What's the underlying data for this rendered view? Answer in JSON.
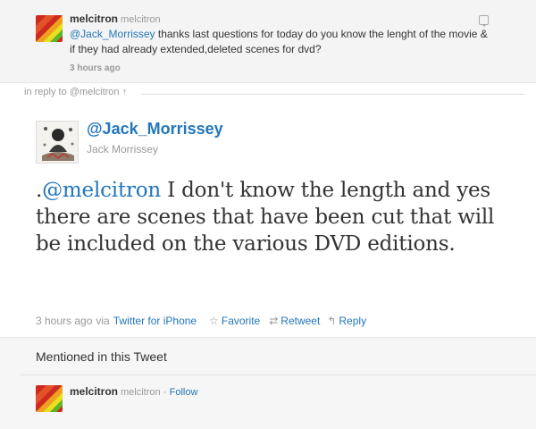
{
  "in_reply_to": {
    "user_name": "melcitron",
    "screen_name": "melcitron",
    "mention": "@Jack_Morrissey",
    "text_rest": " thanks last questions for today do you know the lenght of the movie & if they had already extended,deleted scenes for dvd?",
    "time": "3 hours ago"
  },
  "conversation": {
    "in_reply_label": "in reply to @melcitron ↑"
  },
  "tweet": {
    "handle": "@Jack_Morrissey",
    "full_name": "Jack Morrissey",
    "prefix": ".",
    "mention": "@melcitron",
    "text_rest": " I don't know the length and yes there are scenes that have been cut that will be included on the various DVD editions.",
    "time": "3 hours ago",
    "via_label": "via",
    "source": "Twitter for iPhone",
    "actions": {
      "favorite": "Favorite",
      "retweet": "Retweet",
      "reply": "Reply"
    }
  },
  "mentioned": {
    "title": "Mentioned in this Tweet",
    "user_name": "melcitron",
    "screen_name": "melcitron",
    "separator": "·",
    "follow_label": "Follow"
  },
  "icons": {
    "avatar_melcitron": "rainbow-avatar",
    "avatar_jack": "sketch-portrait-avatar",
    "reply_bubble": "speech-bubble-icon",
    "favorite": "star-icon",
    "retweet": "retweet-icon",
    "reply": "reply-arrow-icon"
  },
  "colors": {
    "link": "#2276bb",
    "muted": "#999999",
    "text": "#333333",
    "panel_bg": "#f4f4f4"
  }
}
